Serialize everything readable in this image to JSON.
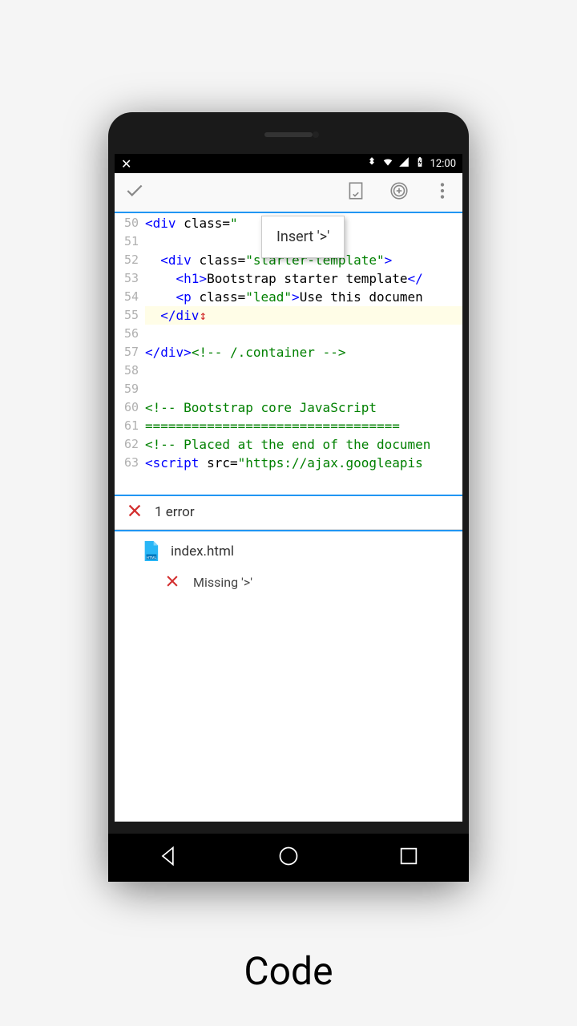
{
  "status": {
    "time": "12:00"
  },
  "tooltip": {
    "text": "Insert '>'"
  },
  "lines": [
    {
      "num": "50"
    },
    {
      "num": "51"
    },
    {
      "num": "52"
    },
    {
      "num": "53"
    },
    {
      "num": "54"
    },
    {
      "num": "55"
    },
    {
      "num": "56"
    },
    {
      "num": "57"
    },
    {
      "num": "58"
    },
    {
      "num": "59"
    },
    {
      "num": "60"
    },
    {
      "num": "61"
    },
    {
      "num": "62"
    },
    {
      "num": "63"
    }
  ],
  "code": {
    "l50_div": "div",
    "l50_class": " class=",
    "l50_q": "\"",
    "l52_div": "div",
    "l52_class": " class=",
    "l52_val": "\"starter-template\"",
    "l53_h1": "h1",
    "l53_text": "Bootstrap starter template",
    "l53_close": "</",
    "l54_p": "p",
    "l54_class": " class=",
    "l54_val": "\"lead\"",
    "l54_text": "Use this documen",
    "l55_close": "</",
    "l55_div": "div",
    "l57_close": "</",
    "l57_div": "div",
    "l57_comment": "<!-- /.container -->",
    "l60_comment": "<!-- Bootstrap core JavaScript",
    "l61_comment": "=================================",
    "l62_comment": "<!-- Placed at the end of the documen",
    "l63_script": "script",
    "l63_src": " src=",
    "l63_val": "\"https://ajax.googleapis"
  },
  "error_bar": {
    "count": "1 error"
  },
  "file": {
    "name": "index.html"
  },
  "error_item": {
    "msg": "Missing '>'"
  },
  "caption": "Code"
}
